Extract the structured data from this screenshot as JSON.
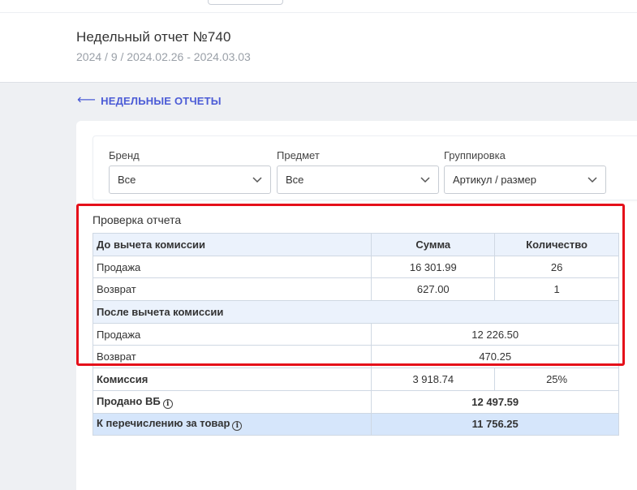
{
  "header": {
    "title": "Недельный отчет №740",
    "subtitle": "2024 / 9 / 2024.02.26 - 2024.03.03"
  },
  "nav": {
    "back_arrow": "⟵",
    "back_label": "НЕДЕЛЬНЫЕ ОТЧЕТЫ"
  },
  "filters": {
    "brand": {
      "label": "Бренд",
      "value": "Все"
    },
    "subject": {
      "label": "Предмет",
      "value": "Все"
    },
    "grouping": {
      "label": "Группировка",
      "value": "Артикул / размер"
    }
  },
  "report_check": {
    "title": "Проверка отчета",
    "columns": [
      "До вычета комиссии",
      "Сумма",
      "Количество"
    ],
    "before_commission": [
      {
        "label": "Продажа",
        "sum": "16 301.99",
        "qty": "26"
      },
      {
        "label": "Возврат",
        "sum": "627.00",
        "qty": "1"
      }
    ],
    "after_commission_label": "После вычета комиссии",
    "after_commission": [
      {
        "label": "Продажа",
        "sum": "12 226.50"
      },
      {
        "label": "Возврат",
        "sum": "470.25"
      }
    ],
    "commission": {
      "label": "Комиссия",
      "sum": "3 918.74",
      "percent": "25%"
    },
    "sold_vb": {
      "label": "Продано ВБ",
      "sum": "12 497.59"
    },
    "to_transfer": {
      "label": "К перечислению за товар",
      "sum": "11 756.25"
    },
    "info_glyph": "i"
  },
  "colors": {
    "accent": "#4b5bd6",
    "highlight_border": "#e5101a",
    "header_row": "#ebf2fc",
    "total_row": "#d6e6fb"
  }
}
